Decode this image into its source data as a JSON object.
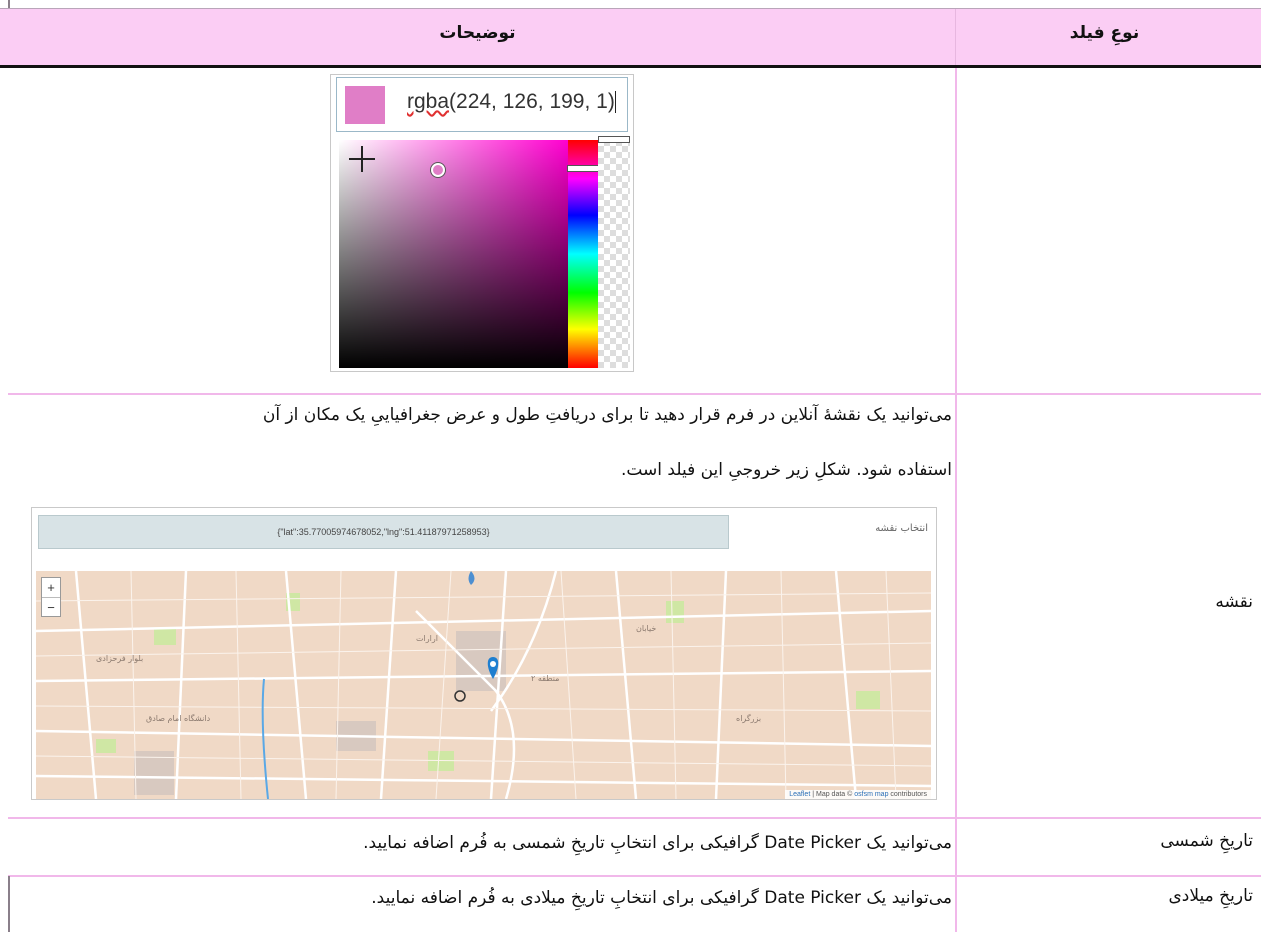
{
  "table": {
    "headers": {
      "description": "توضیحات",
      "field_type": "نوعِ فیلد"
    }
  },
  "color_picker": {
    "swatch_color": "#e07ec7",
    "value_prefix": "rgba",
    "value_rest": "(224, 126, 199, 1)"
  },
  "map_row": {
    "field_type": "نقشه",
    "line1": "می‌توانید یک نقشهٔ آنلاین در فرم قرار دهید تا برای دریافتِ طول و عرض جغرافیاییِ یک مکان از آن",
    "line2": "استفاده شود. شکلِ زیر خروجیِ این فیلد است.",
    "map": {
      "latlng_value": "{\"lat\":35.77005974678052,\"lng\":51.41187971258953}",
      "label": "انتخاب نقشه",
      "zoom_in": "+",
      "zoom_out": "−",
      "attribution_leaflet": "Leaflet",
      "attribution_mid": " | Map data © ",
      "attribution_osm": "osfsm map",
      "attribution_tail": " contributors"
    }
  },
  "shamsi_row": {
    "field_type": "تاریخِ شمسی",
    "description": "می‌توانید یک Date Picker گرافیکی برای انتخابِ تاریخِ شمسی به فُرم اضافه نمایید."
  },
  "miladi_row": {
    "field_type": "تاریخِ میلادی",
    "description": "می‌توانید یک Date Picker گرافیکی برای انتخابِ تاریخِ میلادی به فُرم اضافه نمایید."
  }
}
